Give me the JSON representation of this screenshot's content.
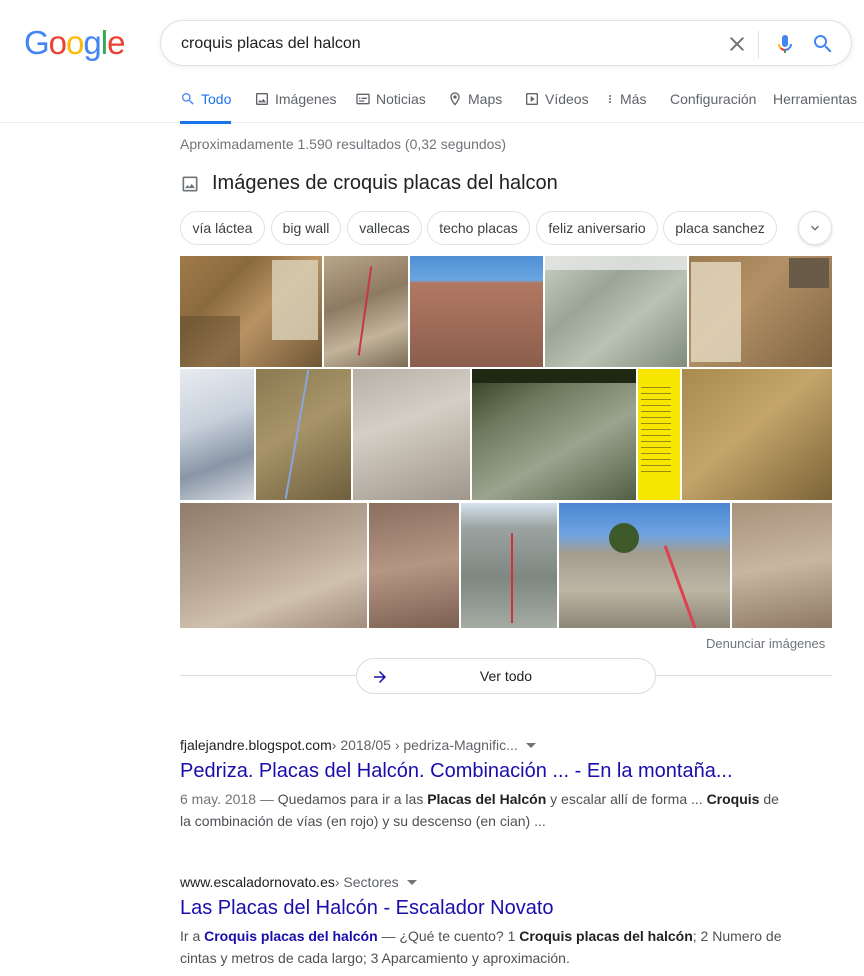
{
  "logo": {
    "text": "Google",
    "letters": [
      "G",
      "o",
      "o",
      "g",
      "l",
      "e"
    ],
    "colors": [
      "#4285F4",
      "#EA4335",
      "#FBBC05",
      "#4285F4",
      "#34A853",
      "#EA4335"
    ]
  },
  "search": {
    "query": "croquis placas del halcon"
  },
  "tabs": [
    {
      "label": "Todo",
      "icon": "search-icon",
      "active": true
    },
    {
      "label": "Imágenes",
      "icon": "image-icon"
    },
    {
      "label": "Noticias",
      "icon": "news-icon"
    },
    {
      "label": "Maps",
      "icon": "map-pin-icon"
    },
    {
      "label": "Vídeos",
      "icon": "video-icon"
    },
    {
      "label": "Más",
      "icon": "more-vert-icon"
    },
    {
      "label": "Configuración"
    },
    {
      "label": "Herramientas"
    }
  ],
  "result_stats": "Aproximadamente 1.590 resultados (0,32 segundos)",
  "images_section": {
    "title": "Imágenes de croquis placas del halcon",
    "chips": [
      "vía láctea",
      "big wall",
      "vallecas",
      "techo placas",
      "feliz aniversario",
      "placa sanchez"
    ],
    "report": "Denunciar imágenes",
    "view_all": "Ver todo"
  },
  "results": [
    {
      "domain": "fjalejandre.blogspot.com",
      "path": " › 2018/05 › pedriza-Magnific...",
      "title": "Pedriza. Placas del Halcón. Combinación ... - En la montaña...",
      "date": "6 may. 2018 — ",
      "snippet_parts": [
        "Quedamos para ir a las ",
        "Placas del Halcón",
        " y escalar allí de forma ... ",
        "Croquis",
        " de la combinación de vías (en rojo) y su descenso (en cian) ..."
      ]
    },
    {
      "domain": "www.escaladornovato.es",
      "path": " › Sectores",
      "title": "Las Placas del Halcón - Escalador Novato",
      "snippet_parts": [
        "Ir a ",
        "Croquis placas del halcón",
        " — ¿Qué te cuento? 1 ",
        "Croquis placas del halcón",
        "; 2 Numero de cintas y metros de cada largo; 3 Aparcamiento y aproximación."
      ]
    }
  ]
}
